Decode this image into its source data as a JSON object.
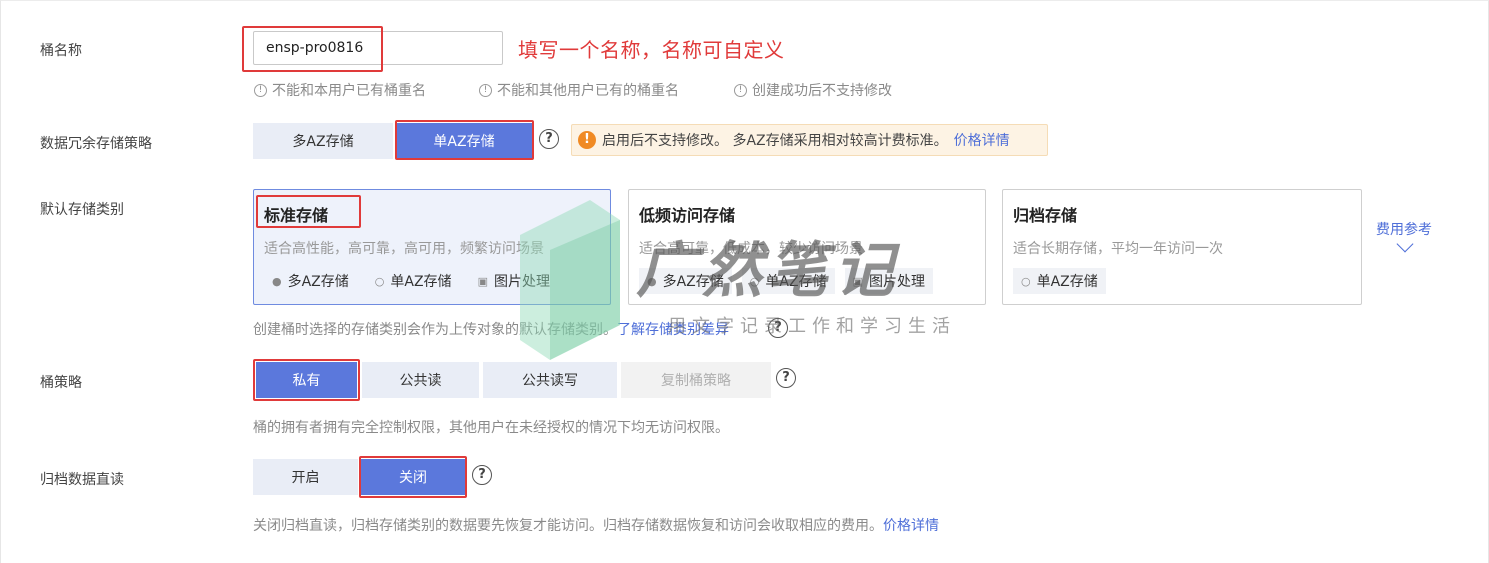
{
  "bucket_name": {
    "label": "桶名称",
    "value": "ensp-pro0816",
    "annotation": "填写一个名称，名称可自定义",
    "hints": [
      "不能和本用户已有桶重名",
      "不能和其他用户已有的桶重名",
      "创建成功后不支持修改"
    ]
  },
  "redundancy": {
    "label": "数据冗余存储策略",
    "options": [
      "多AZ存储",
      "单AZ存储"
    ],
    "selected": "单AZ存储",
    "warning_text": "启用后不支持修改。 多AZ存储采用相对较高计费标准。",
    "warning_link": "价格详情"
  },
  "storage_class": {
    "label": "默认存储类别",
    "cards": [
      {
        "title": "标准存储",
        "desc": "适合高性能，高可靠，高可用，频繁访问场景",
        "tags": [
          "多AZ存储",
          "单AZ存储",
          "图片处理"
        ],
        "selected": true
      },
      {
        "title": "低频访问存储",
        "desc": "适合高可靠，低成本，较少访问场景",
        "tags": [
          "多AZ存储",
          "单AZ存储",
          "图片处理"
        ],
        "selected": false
      },
      {
        "title": "归档存储",
        "desc": "适合长期存储，平均一年访问一次",
        "tags": [
          "单AZ存储"
        ],
        "selected": false
      }
    ],
    "fee_link": "费用参考",
    "note": "创建桶时选择的存储类别会作为上传对象的默认存储类别。",
    "note_link": "了解存储类别差异"
  },
  "policy": {
    "label": "桶策略",
    "options": [
      "私有",
      "公共读",
      "公共读写",
      "复制桶策略"
    ],
    "selected": "私有",
    "note": "桶的拥有者拥有完全控制权限，其他用户在未经授权的情况下均无访问权限。"
  },
  "archive_read": {
    "label": "归档数据直读",
    "options": [
      "开启",
      "关闭"
    ],
    "selected": "关闭",
    "note": "关闭归档直读，归档存储类别的数据要先恢复才能访问。归档存储数据恢复和访问会收取相应的费用。",
    "note_link": "价格详情"
  },
  "watermark": {
    "title": "广然笔记",
    "subtitle": "用文字记录工作和学习生活"
  },
  "colors": {
    "accent": "#5b78dc",
    "annotation_red": "#e03a3a",
    "link": "#4f6fd8",
    "warning": "#f08a24"
  }
}
